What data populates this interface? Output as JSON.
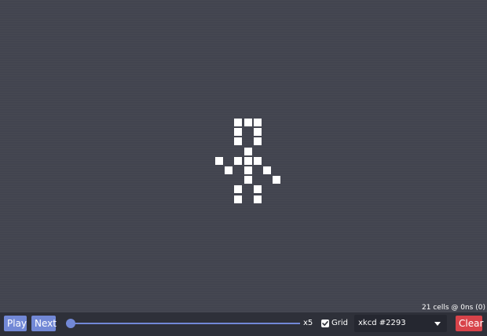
{
  "board": {
    "cells": [
      [
        0,
        2
      ],
      [
        0,
        3
      ],
      [
        0,
        4
      ],
      [
        1,
        2
      ],
      [
        1,
        4
      ],
      [
        2,
        2
      ],
      [
        2,
        4
      ],
      [
        3,
        3
      ],
      [
        4,
        0
      ],
      [
        4,
        2
      ],
      [
        4,
        3
      ],
      [
        4,
        4
      ],
      [
        5,
        1
      ],
      [
        5,
        3
      ],
      [
        5,
        5
      ],
      [
        6,
        3
      ],
      [
        6,
        6
      ],
      [
        7,
        2
      ],
      [
        7,
        4
      ],
      [
        8,
        2
      ],
      [
        8,
        4
      ]
    ]
  },
  "status": "21 cells @ 0ns (0)",
  "toolbar": {
    "play_label": "Play",
    "next_label": "Next",
    "speed": {
      "label": "x5",
      "value_fraction": 0.0
    },
    "grid": {
      "label": "Grid",
      "checked": true
    },
    "preset": {
      "selected": "xkcd #2293"
    },
    "clear_label": "Clear"
  },
  "colors": {
    "background": "#42444f",
    "toolbar": "#2e3039",
    "accent": "#7288d6",
    "danger": "#d8434a",
    "cell": "#ffffff"
  },
  "icons": {
    "dropdown": "chevron-down-icon",
    "checkbox": "checkmark-icon"
  }
}
